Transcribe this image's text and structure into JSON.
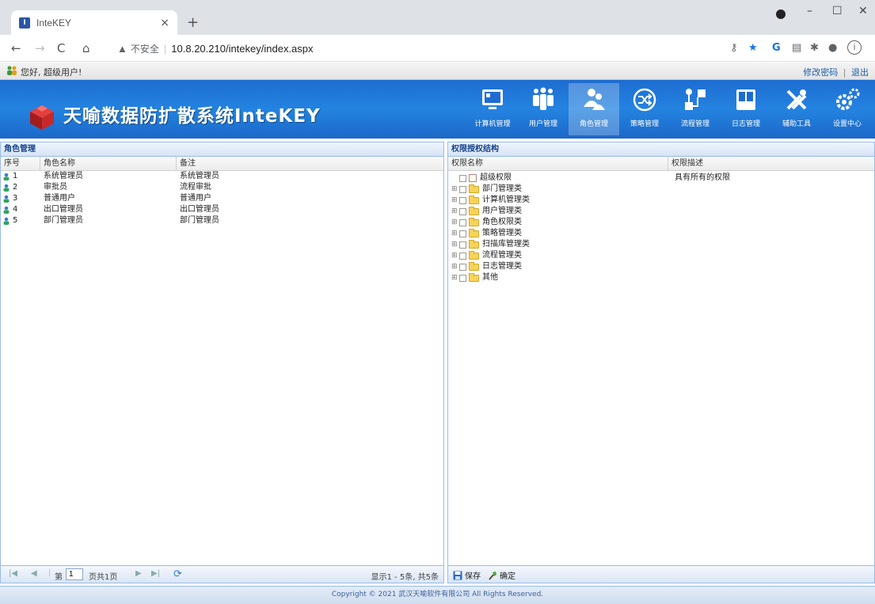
{
  "browser": {
    "tab_title": "InteKEY",
    "insecure_label": "不安全",
    "url": "10.8.20.210/intekey/index.aspx"
  },
  "welcome": {
    "message": "您好, 超级用户!",
    "change_password": "修改密码",
    "separator": "|",
    "logout": "退出"
  },
  "app": {
    "title": "天喻数据防扩散系统InteKEY",
    "nav": [
      {
        "label": "计算机管理",
        "icon": "monitor-icon"
      },
      {
        "label": "用户管理",
        "icon": "users-icon"
      },
      {
        "label": "角色管理",
        "icon": "roles-icon"
      },
      {
        "label": "策略管理",
        "icon": "shuffle-icon"
      },
      {
        "label": "流程管理",
        "icon": "flow-icon"
      },
      {
        "label": "日志管理",
        "icon": "log-icon"
      },
      {
        "label": "辅助工具",
        "icon": "tools-icon"
      },
      {
        "label": "设置中心",
        "icon": "settings-icon"
      }
    ],
    "active_nav": "角色管理"
  },
  "roles_panel": {
    "title": "角色管理",
    "columns": [
      "序号",
      "角色名称",
      "备注"
    ],
    "rows": [
      {
        "no": "1",
        "name": "系统管理员",
        "remark": "系统管理员"
      },
      {
        "no": "2",
        "name": "审批员",
        "remark": "流程审批"
      },
      {
        "no": "3",
        "name": "普通用户",
        "remark": "普通用户"
      },
      {
        "no": "4",
        "name": "出口管理员",
        "remark": "出口管理员"
      },
      {
        "no": "5",
        "name": "部门管理员",
        "remark": "部门管理员"
      }
    ],
    "pager": {
      "page_prefix": "第",
      "page_value": "1",
      "page_suffix": "页共1页",
      "display_info": "显示1 - 5条, 共5条"
    }
  },
  "perm_panel": {
    "title": "权限授权结构",
    "columns": [
      "权限名称",
      "权限描述"
    ],
    "tree": [
      {
        "label": "超级权限",
        "desc": "具有所有的权限",
        "type": "leaf"
      },
      {
        "label": "部门管理类",
        "desc": "",
        "type": "folder"
      },
      {
        "label": "计算机管理类",
        "desc": "",
        "type": "folder"
      },
      {
        "label": "用户管理类",
        "desc": "",
        "type": "folder"
      },
      {
        "label": "角色权限类",
        "desc": "",
        "type": "folder"
      },
      {
        "label": "策略管理类",
        "desc": "",
        "type": "folder"
      },
      {
        "label": "扫描库管理类",
        "desc": "",
        "type": "folder"
      },
      {
        "label": "流程管理类",
        "desc": "",
        "type": "folder"
      },
      {
        "label": "日志管理类",
        "desc": "",
        "type": "folder"
      },
      {
        "label": "其他",
        "desc": "",
        "type": "folder"
      }
    ],
    "save_label": "保存",
    "confirm_label": "确定"
  },
  "footer": {
    "copyright": "Copyright © 2021 武汉天喻软件有限公司 All Rights Reserved."
  },
  "colors": {
    "header_blue": "#1d6dd1",
    "panel_border": "#99bbe8",
    "panel_title": "#15428b"
  }
}
